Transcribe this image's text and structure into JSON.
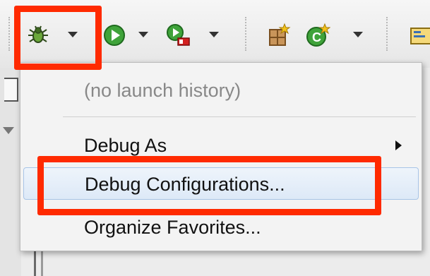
{
  "toolbar": {
    "buttons": [
      {
        "name": "debug-button",
        "icon": "bug-icon"
      },
      {
        "name": "run-button",
        "icon": "run-icon"
      },
      {
        "name": "coverage-button",
        "icon": "coverage-icon"
      },
      {
        "name": "new-package-button",
        "icon": "package-icon"
      },
      {
        "name": "new-class-button",
        "icon": "class-icon"
      },
      {
        "name": "open-type-button",
        "icon": "open-type-icon"
      }
    ]
  },
  "debug_menu": {
    "history_placeholder": "(no launch history)",
    "items": [
      {
        "label": "Debug As",
        "has_submenu": true
      },
      {
        "label": "Debug Configurations...",
        "highlighted": true
      },
      {
        "label": "Organize Favorites..."
      }
    ]
  },
  "colors": {
    "highlight": "#ff2a00",
    "hover_bg": "#dde9f7",
    "menu_bg": "#f3f3f3"
  }
}
